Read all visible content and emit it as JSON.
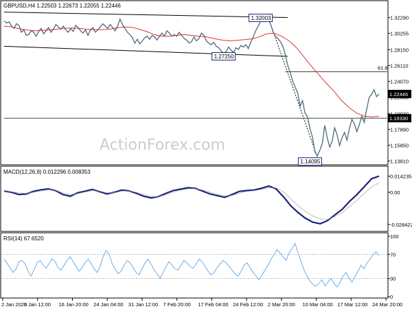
{
  "watermark": "ActionForex.com",
  "colors": {
    "price": "#4a6a7a",
    "ma": "#e03030",
    "trendline": "#000000",
    "macd": "#1a237e",
    "signal": "#9e9e9e",
    "rsi": "#6aaee8",
    "level_line": "#000000",
    "box_fill": "#ffffff",
    "box_border": "#1a237e"
  },
  "chart_data": [
    {
      "type": "line",
      "panel": "price",
      "title": "GBPUSD,H4  1.22503 1.22673 1.22055 1.22446",
      "ylim": [
        1.135,
        1.335
      ],
      "y_ticks": [
        "1.32290",
        "1.30255",
        "1.28150",
        "1.26110",
        "1.24070",
        "1.22030",
        "1.19930",
        "1.17890",
        "1.15850",
        "1.13810"
      ],
      "x_ticks": [
        "2 Jan 2020",
        "9 Jan 12:00",
        "16 Jan 20:00",
        "24 Jan 04:00",
        "31 Jan 12:00",
        "7 Feb 20:00",
        "17 Feb 04:00",
        "24 Feb 12:00",
        "2 Mar 20:00",
        "10 Mar 04:00",
        "17 Mar 12:00",
        "24 Mar 20:00"
      ],
      "series": [
        {
          "role": "price",
          "values": [
            1.3185,
            1.316,
            1.3175,
            1.312,
            1.309,
            1.315,
            1.313,
            1.304,
            1.307,
            1.3,
            1.301,
            1.306,
            1.304,
            1.299,
            1.305,
            1.309,
            1.302,
            1.306,
            1.31,
            1.304,
            1.308,
            1.314,
            1.311,
            1.308,
            1.312,
            1.307,
            1.304,
            1.309,
            1.305,
            1.313,
            1.31,
            1.306,
            1.303,
            1.307,
            1.3,
            1.307,
            1.31,
            1.304,
            1.307,
            1.311,
            1.315,
            1.312,
            1.309,
            1.314,
            1.31,
            1.306,
            1.312,
            1.321,
            1.314,
            1.309,
            1.304,
            1.301,
            1.297,
            1.29,
            1.295,
            1.289,
            1.293,
            1.297,
            1.299,
            1.295,
            1.3,
            1.298,
            1.294,
            1.299,
            1.303,
            1.299,
            1.306,
            1.303,
            1.299,
            1.301,
            1.299,
            1.304,
            1.3,
            1.296,
            1.294,
            1.29,
            1.292,
            1.298,
            1.293,
            1.296,
            1.303,
            1.3,
            1.293,
            1.29,
            1.288,
            1.291,
            1.286,
            1.284,
            1.28,
            1.2773,
            1.279,
            1.285,
            1.281,
            1.278,
            1.284,
            1.282,
            1.287,
            1.285,
            1.288,
            1.283,
            1.291,
            1.298,
            1.306,
            1.312,
            1.318,
            1.324,
            1.318,
            1.321,
            1.315,
            1.305,
            1.299,
            1.296,
            1.292,
            1.286,
            1.275,
            1.261,
            1.252,
            1.241,
            1.233,
            1.226,
            1.209,
            1.216,
            1.2,
            1.195,
            1.18,
            1.169,
            1.15,
            1.145,
            1.152,
            1.161,
            1.184,
            1.168,
            1.156,
            1.164,
            1.181,
            1.172,
            1.158,
            1.168,
            1.175,
            1.165,
            1.18,
            1.192,
            1.186,
            1.176,
            1.185,
            1.196,
            1.188,
            1.205,
            1.22,
            1.224,
            1.23,
            1.221,
            1.2245
          ]
        },
        {
          "role": "moving-average",
          "values": [
            1.312,
            1.311,
            1.3085,
            1.307,
            1.306,
            1.3065,
            1.307,
            1.308,
            1.309,
            1.3095,
            1.309,
            1.308,
            1.3075,
            1.3075,
            1.308,
            1.3095,
            1.311,
            1.3105,
            1.308,
            1.305,
            1.301,
            1.299,
            1.299,
            1.3,
            1.301,
            1.3,
            1.299,
            1.298,
            1.296,
            1.294,
            1.293,
            1.2935,
            1.2945,
            1.2955,
            1.298,
            1.302,
            1.303,
            1.299,
            1.293,
            1.284,
            1.272,
            1.26,
            1.249,
            1.238,
            1.228,
            1.216,
            1.207,
            1.2,
            1.196,
            1.195,
            1.196
          ]
        }
      ],
      "trendlines": [
        {
          "from": {
            "index": 0,
            "value": 1.33
          },
          "to": {
            "index": 115,
            "value": 1.323
          }
        },
        {
          "from": {
            "index": 0,
            "value": 1.286
          },
          "to": {
            "index": 115,
            "value": 1.273
          }
        },
        {
          "from": {
            "index": 107,
            "value": 1.324
          },
          "to": {
            "index": 127,
            "value": 1.143
          },
          "dashed": true
        }
      ],
      "levels": [
        {
          "value": 1.253,
          "label": "61.8",
          "from_index": 114
        },
        {
          "value": 1.2245,
          "label": "",
          "from_index": 0,
          "line": false
        },
        {
          "value": 1.1933,
          "label": "",
          "from_index": 0
        }
      ],
      "price_boxes": [
        {
          "text": "1.32003",
          "index": 104,
          "value": 1.3226
        },
        {
          "text": "1.27250",
          "index": 89,
          "value": 1.273
        },
        {
          "text": "1.14095",
          "index": 124,
          "value": 1.1375
        }
      ],
      "axis_boxes": [
        {
          "text": "1.22446",
          "value": 1.2245,
          "dark": true
        },
        {
          "text": "1.19330",
          "value": 1.1933,
          "dark": true
        }
      ]
    },
    {
      "type": "line",
      "panel": "macd",
      "title": "MACD(12,26,9) 0.012296 0.008353",
      "ylim": [
        -0.034,
        0.017
      ],
      "y_ticks": [
        "0.014235",
        "0.00",
        "-0.028422"
      ],
      "series": [
        {
          "role": "macd",
          "values": [
            0.001,
            0.0,
            -0.002,
            -0.0015,
            0.0008,
            0.0022,
            0.003,
            0.0015,
            -0.002,
            -0.0035,
            -0.0005,
            0.001,
            0.0025,
            0.0005,
            -0.0015,
            0.0,
            0.002,
            0.0012,
            -0.001,
            -0.0035,
            -0.005,
            -0.0038,
            -0.001,
            0.0015,
            0.0028,
            0.004,
            0.0035,
            0.001,
            -0.0015,
            -0.003,
            -0.0045,
            -0.002,
            0.0008,
            0.0015,
            0.002,
            0.0035,
            0.0055,
            0.003,
            -0.004,
            -0.012,
            -0.018,
            -0.023,
            -0.0265,
            -0.0278,
            -0.025,
            -0.02,
            -0.015,
            -0.008,
            -0.002,
            0.005,
            0.012,
            0.0142
          ]
        },
        {
          "role": "signal",
          "values": [
            0.0005,
            0.0004,
            -0.0005,
            -0.001,
            0.0,
            0.0012,
            0.0022,
            0.0018,
            -0.0005,
            -0.0022,
            -0.0012,
            0.0002,
            0.0016,
            0.001,
            -0.0005,
            -0.0004,
            0.001,
            0.0012,
            0.0,
            -0.002,
            -0.0038,
            -0.004,
            -0.0022,
            0.0002,
            0.0018,
            0.003,
            0.0033,
            0.002,
            0.0,
            -0.0018,
            -0.0032,
            -0.0028,
            -0.0008,
            0.0007,
            0.0014,
            0.0025,
            0.004,
            0.0038,
            0.0005,
            -0.006,
            -0.012,
            -0.017,
            -0.021,
            -0.0235,
            -0.024,
            -0.0215,
            -0.018,
            -0.0125,
            -0.007,
            -0.001,
            0.005,
            0.0084
          ]
        }
      ]
    },
    {
      "type": "line",
      "panel": "rsi",
      "title": "RSI(14) 67.6520",
      "ylim": [
        0,
        100
      ],
      "y_ticks": [
        "100",
        "70",
        "30",
        "0"
      ],
      "levels": [
        70,
        30
      ],
      "series": [
        {
          "role": "rsi",
          "values": [
            62,
            55,
            48,
            40,
            46,
            58,
            60,
            54,
            42,
            34,
            45,
            56,
            60,
            52,
            47,
            55,
            63,
            58,
            48,
            44,
            52,
            60,
            66,
            58,
            50,
            42,
            48,
            56,
            62,
            55,
            46,
            40,
            50,
            66,
            76,
            70,
            55,
            46,
            38,
            42,
            52,
            60,
            56,
            48,
            40,
            36,
            46,
            56,
            62,
            54,
            44,
            38,
            30,
            40,
            50,
            58,
            52,
            46,
            44,
            52,
            60,
            56,
            50,
            47,
            54,
            62,
            58,
            50,
            42,
            36,
            40,
            48,
            54,
            60,
            56,
            50,
            44,
            38,
            34,
            42,
            52,
            56,
            48,
            40,
            34,
            28,
            36,
            44,
            52,
            62,
            70,
            78,
            72,
            66,
            60,
            72,
            80,
            88,
            72,
            58,
            44,
            34,
            26,
            20,
            17,
            22,
            28,
            18,
            24,
            30,
            22,
            16,
            24,
            34,
            40,
            30,
            24,
            34,
            42,
            52,
            46,
            56,
            62,
            70,
            74,
            68
          ]
        }
      ]
    }
  ]
}
